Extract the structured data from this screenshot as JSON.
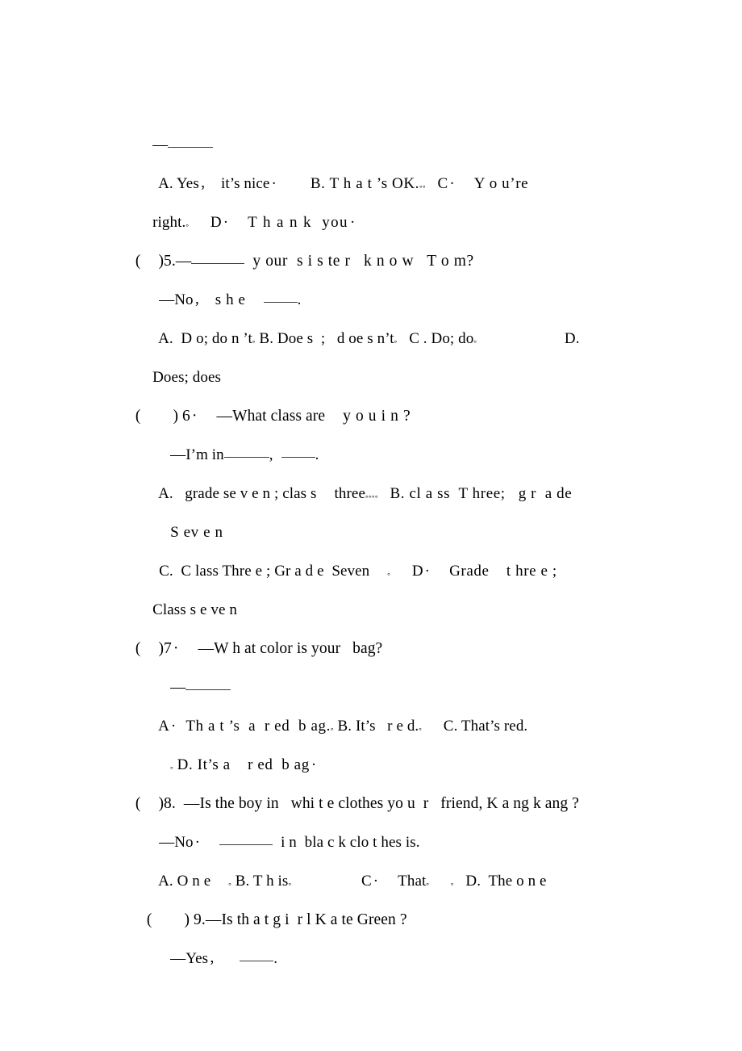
{
  "document": {
    "kind": "scanned-worksheet",
    "subject": "English multiple-choice exercise",
    "page_background": "#ffffff",
    "text_color": "#000000",
    "rule_color": "#3a3a3a"
  },
  "lines": {
    "l01_dash": "—",
    "q4_options_a": "A. Yes",
    "q4_options_a2": "it’s nice",
    "q4_options_b": "B. T h a t ’s OK.",
    "q4_options_c": "C",
    "q4_options_c2": "Y o u’re",
    "q4_options_c3": "right.",
    "q4_options_d": "D",
    "q4_options_d2": "T h a n k  you",
    "q5_marker": "(",
    "q5_marker_close": ")5.",
    "q5_dash": "—",
    "q5_stem": "y our  s i s te r   k n o w   T o m?",
    "q5_answer_dash": "—No",
    "q5_answer_text": "s h e",
    "q5_answer_period": ".",
    "q5_opt_a": "A.  D o; do n ’t",
    "q5_opt_b": "B. Doe s  ;   d oe s n’t",
    "q5_opt_c": "C . Do; do",
    "q5_opt_d": "D.",
    "q5_opt_d_cont": "Does; does",
    "q6_marker": "(",
    "q6_marker_close": ") 6",
    "q6_stem_dash": "—What class are",
    "q6_stem_text": "y o u i n ?",
    "q6_answer_dash": "—I’m in",
    "q6_answer_comma": ",",
    "q6_answer_period": ".",
    "q6_opt_a": "A.   grade se v e n ; clas s",
    "q6_opt_a2": "three",
    "q6_opt_b": "B. cl a ss  T hree;   g r  a de",
    "q6_opt_b_cont": "S ev e n",
    "q6_opt_c": "C.  C lass Thre e ; Gr a d e  Seven",
    "q6_opt_d": "D",
    "q6_opt_d2": "Grade    t hre e ;",
    "q6_opt_d_cont": "Class s e ve n",
    "q7_marker": "(",
    "q7_marker_close": ")7",
    "q7_stem": "—W h at color is your   bag?",
    "q7_answer_dash": "—",
    "q7_opt_a": "A",
    "q7_opt_a2": "Th a t ’s  a  r ed  b ag.",
    "q7_opt_b": "B. It’s   r e d.",
    "q7_opt_c": "C. That’s red.",
    "q7_opt_d": "D. It’s a    r ed  b ag",
    "q8_marker": "(",
    "q8_marker_close": ")8.",
    "q8_stem": "—Is the boy in   whi t e clothes yo u  r   friend, K a ng k ang ?",
    "q8_answer_dash": "—No",
    "q8_answer_text": "i n  bla c k clo t hes is.",
    "q8_opt_a": "A. O n e",
    "q8_opt_b": "B. T h is",
    "q8_opt_c": "C",
    "q8_opt_c2": "That",
    "q8_opt_d": "D.  The o n e",
    "q9_marker": "(",
    "q9_marker_close": ") 9.",
    "q9_stem": "—Is th a t g i  r l K a te Green ?",
    "q9_answer_dash": "—Yes",
    "q9_answer_period": "."
  },
  "glyphs": {
    "cjk_full_stop": "。",
    "cjk_comma": "，",
    "middot": "·",
    "em_dash": "—"
  }
}
